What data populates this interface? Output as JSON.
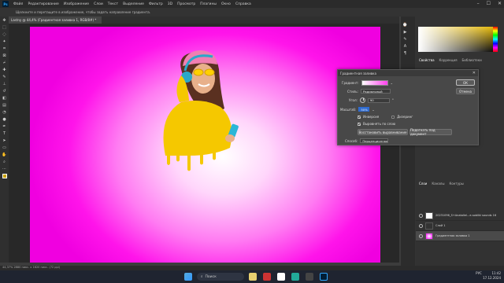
{
  "app": {
    "logo": "Ps"
  },
  "menu": [
    "Файл",
    "Редактирование",
    "Изображение",
    "Слои",
    "Текст",
    "Выделение",
    "Фильтр",
    "3D",
    "Просмотр",
    "Плагины",
    "Окно",
    "Справка"
  ],
  "options_hint": "Щелкните и перетащите в изображение, чтобы задать направление градиента.",
  "document_tab": "Lastny @ 44,4% (Градиентная заливка 1, RGB/8#) *",
  "status_bar": "44,37%    2880 пикс. x 1620 пикс. (72 ppi)",
  "dialog": {
    "title": "Градиентная заливка",
    "gradient_label": "Градиент:",
    "style_label": "Стиль:",
    "style_value": "Радиальный",
    "angle_label": "Угол:",
    "angle_value": "90",
    "scale_label": "Масштаб:",
    "scale_value": "50%",
    "reverse_label": "Инверсия",
    "dither_label": "Дизеринг",
    "align_label": "Выровнять по слою",
    "reset_button": "Восстановить выравнивание",
    "fit_button": "Подогнать под документ",
    "method_label": "Способ:",
    "method_value": "Перцепционная",
    "ok_button": "ОК",
    "cancel_button": "Отмена",
    "reverse_checked": true,
    "dither_checked": false,
    "align_checked": true
  },
  "right_panel": {
    "tabs": [
      "Свойства",
      "Коррекция",
      "Библиотеки"
    ],
    "layers_tabs": [
      "Слои",
      "Каналы",
      "Контуры"
    ],
    "layers": [
      {
        "name": "20231096_S+Anatoliel...e-sobliki sounds 16"
      },
      {
        "name": "Слой 1"
      },
      {
        "name": "Градиентная заливка 1"
      }
    ]
  },
  "taskbar": {
    "search_placeholder": "Поиск",
    "time": "11:42",
    "date": "17.12.2024",
    "lang": "РУС"
  },
  "colors": {
    "accent": "#31a8ff",
    "canvas_edge": "#f000e0"
  }
}
